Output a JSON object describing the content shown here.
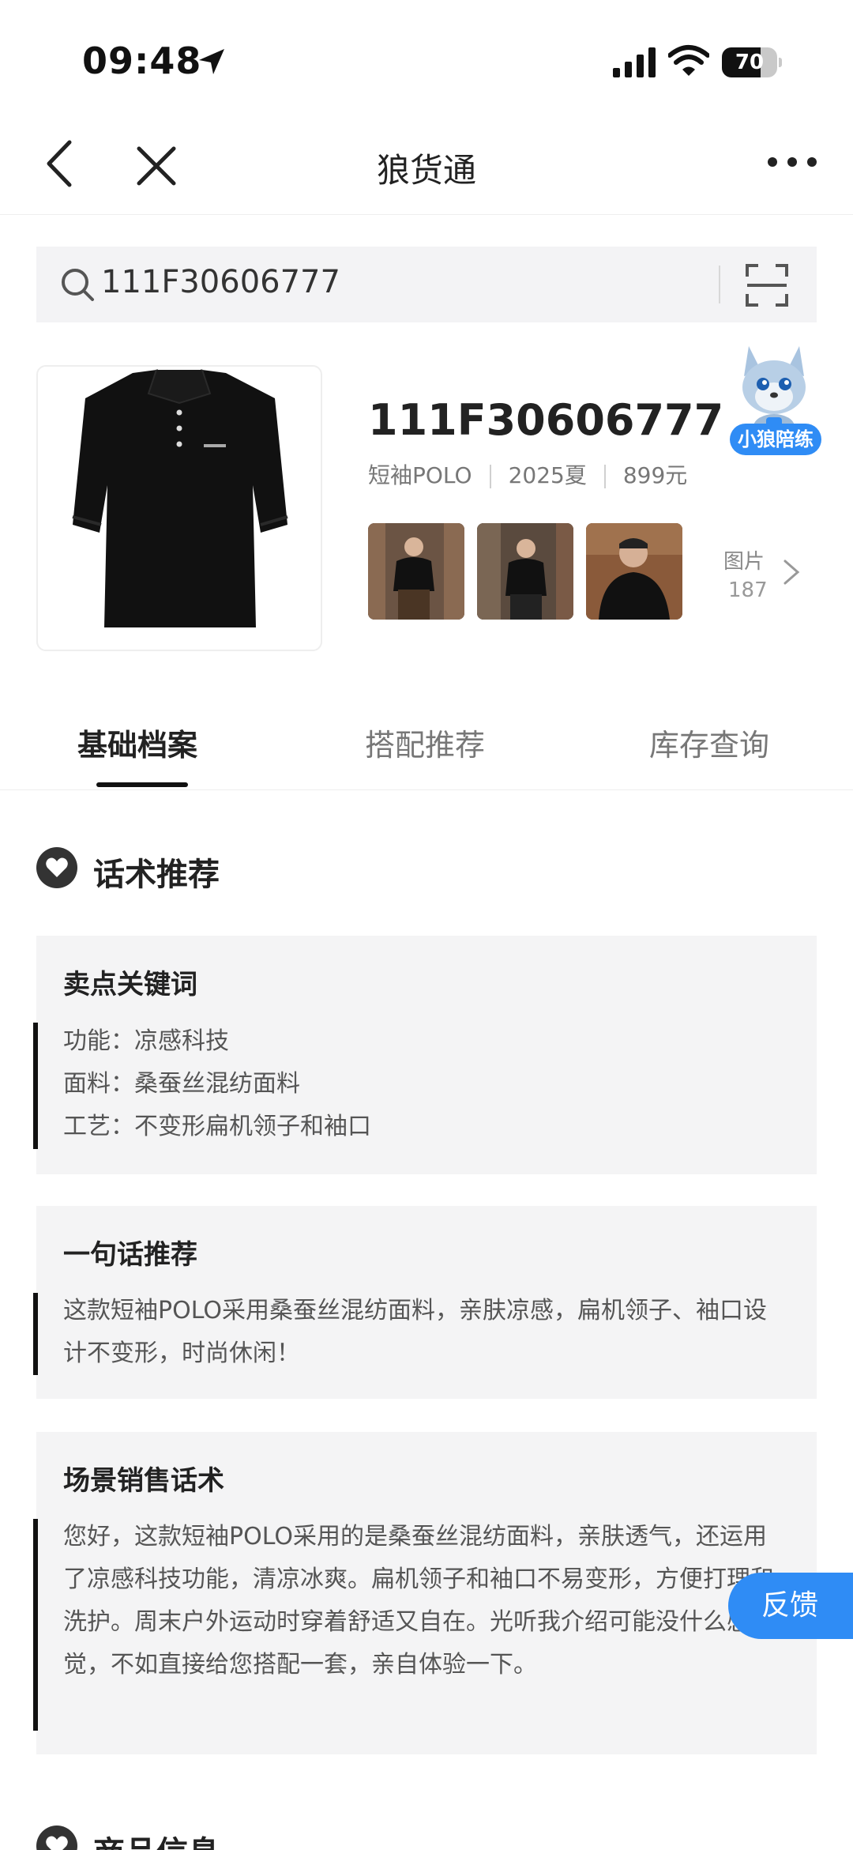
{
  "status_bar": {
    "time": "09:48",
    "battery": "70",
    "battery_level": 0.7
  },
  "nav": {
    "title": "狼货通"
  },
  "search": {
    "value": "111F30606777"
  },
  "product": {
    "code": "111F30606777",
    "category": "短袖POLO",
    "season": "2025夏",
    "price": "899元",
    "photos_label": "图片",
    "photos_count": "187",
    "mascot_label": "小狼陪练"
  },
  "tabs": [
    "基础档案",
    "搭配推荐",
    "库存查询"
  ],
  "section": {
    "title": "话术推荐"
  },
  "keywords_card": {
    "title": "卖点关键词",
    "lines": [
      "功能：凉感科技",
      "面料：桑蚕丝混纺面料",
      "工艺：不变形扁机领子和袖口"
    ]
  },
  "one_line_card": {
    "title": "一句话推荐",
    "text": "这款短袖POLO采用桑蚕丝混纺面料，亲肤凉感，扁机领子、袖口设计不变形，时尚休闲！"
  },
  "scene_card": {
    "title": "场景销售话术",
    "text": "您好，这款短袖POLO采用的是桑蚕丝混纺面料，亲肤透气，还运用了凉感科技功能，清凉冰爽。扁机领子和袖口不易变形，方便打理和洗护。周末户外运动时穿着舒适又自在。光听我介绍可能没什么感觉，不如直接给您搭配一套，亲自体验一下。"
  },
  "feedback": {
    "label": "反馈"
  },
  "section2": {
    "title": "商品信息"
  }
}
